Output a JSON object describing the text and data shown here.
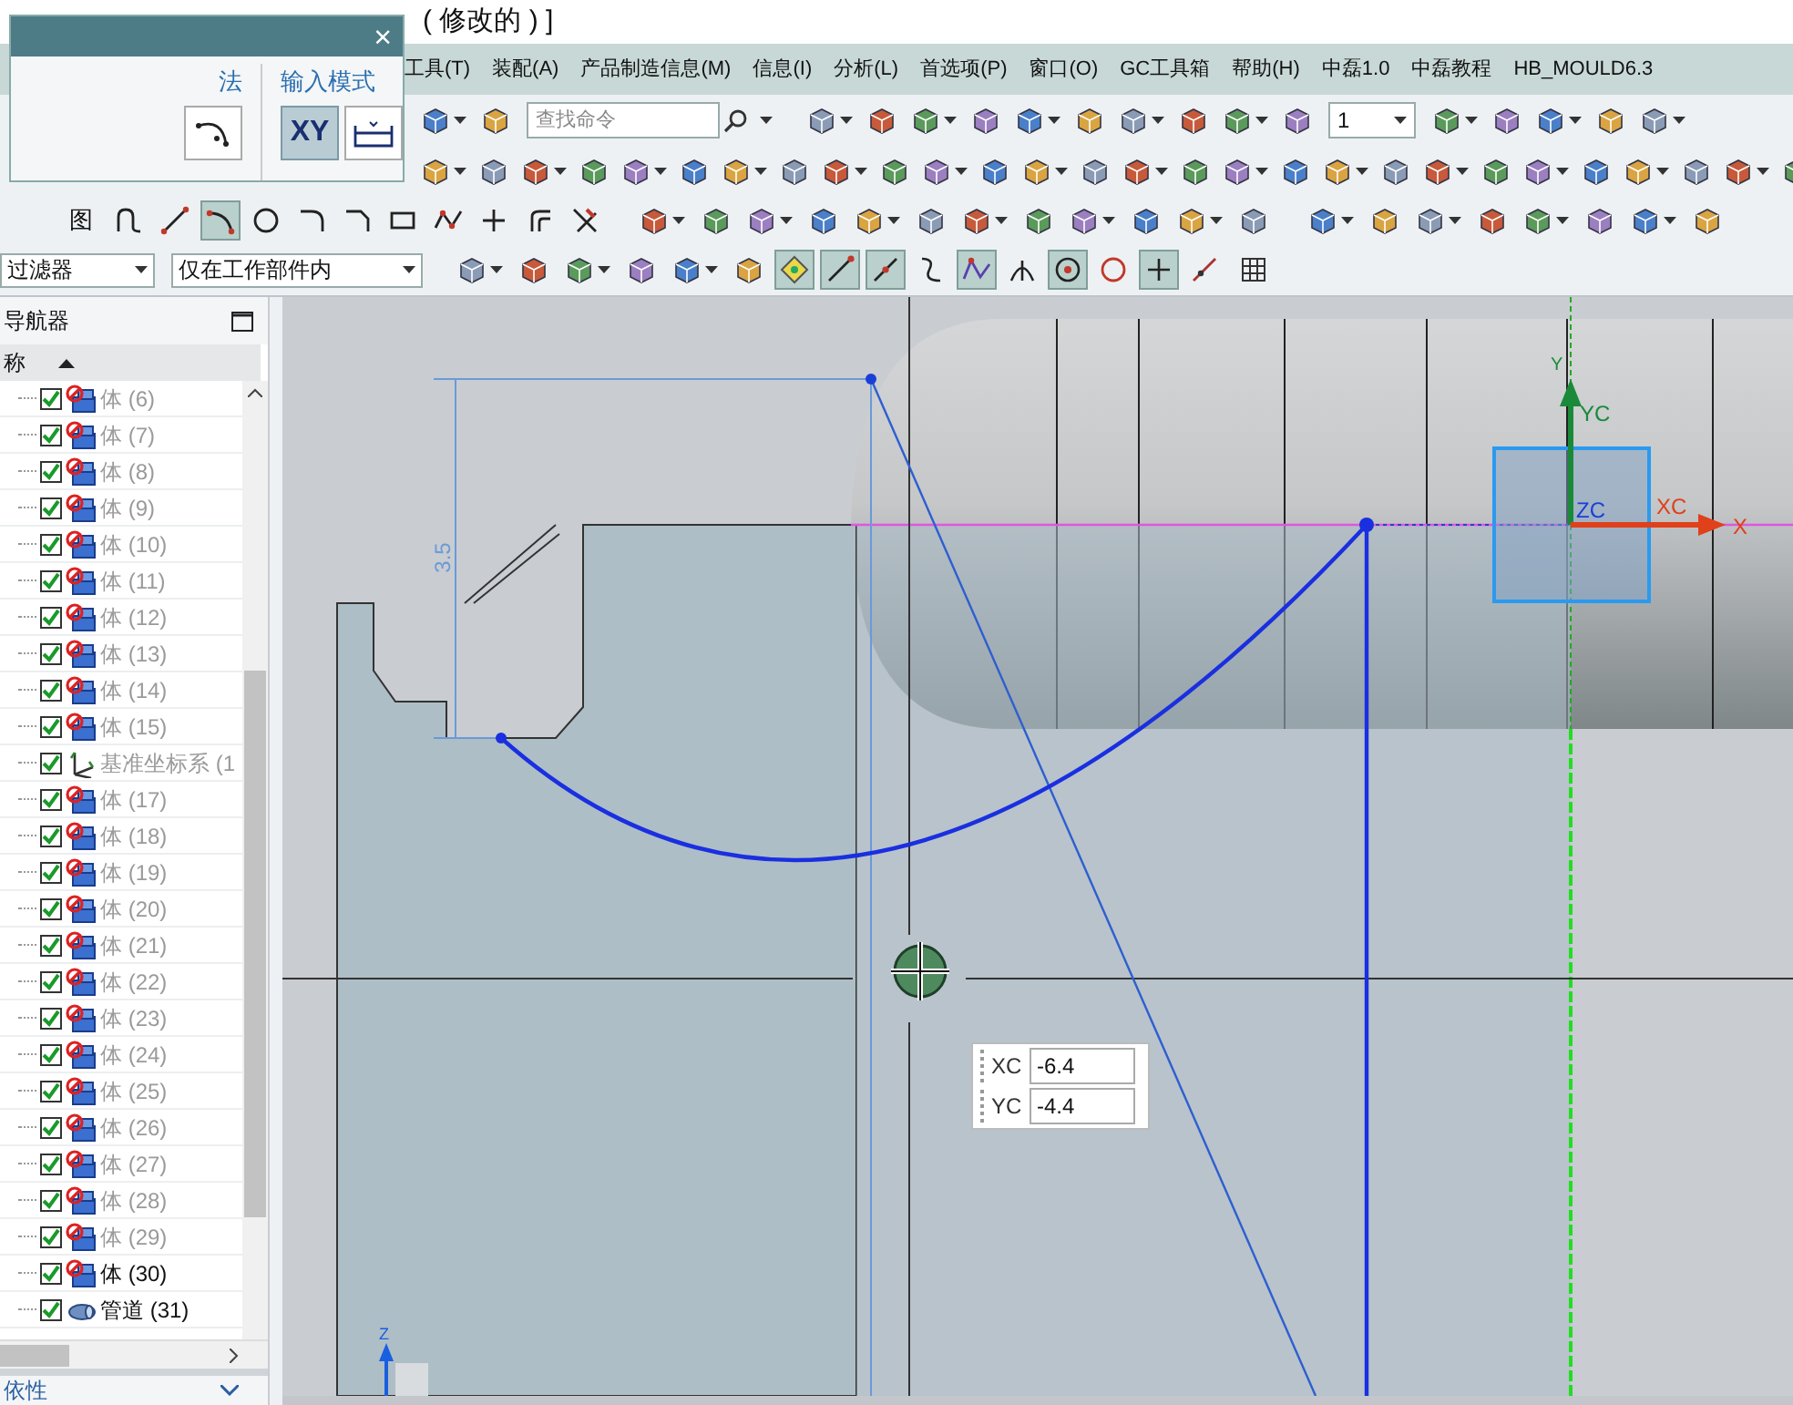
{
  "window": {
    "title": "( 修改的 ) ]"
  },
  "menu": [
    "工具(T)",
    "装配(A)",
    "产品制造信息(M)",
    "信息(I)",
    "分析(L)",
    "首选项(P)",
    "窗口(O)",
    "GC工具箱",
    "帮助(H)",
    "中磊1.0",
    "中磊教程",
    "HB_MOULD6.3"
  ],
  "input_dialog": {
    "close": "×",
    "sections": [
      "法",
      "输入模式"
    ],
    "mode_button": {
      "label": "XY",
      "selected": true
    }
  },
  "toolbar": {
    "search": {
      "placeholder": "查找命令"
    },
    "layer_combo": {
      "value": "1"
    },
    "sketch_label": "图",
    "sketch_tools": [
      {
        "kind": "profile",
        "selected": false
      },
      {
        "kind": "line",
        "selected": false
      },
      {
        "kind": "arc",
        "selected": true
      },
      {
        "kind": "circle",
        "selected": false
      },
      {
        "kind": "fillet",
        "selected": false
      },
      {
        "kind": "chamfer",
        "selected": false
      },
      {
        "kind": "rectangle",
        "selected": false
      },
      {
        "kind": "spline",
        "selected": false
      },
      {
        "kind": "point",
        "selected": false
      },
      {
        "kind": "offset",
        "selected": false
      },
      {
        "kind": "trim",
        "selected": false
      }
    ],
    "filter": {
      "value": "过滤器"
    },
    "scope": {
      "value": "仅在工作部件内"
    },
    "snap_tools": [
      {
        "kind": "auto",
        "selected": true
      },
      {
        "kind": "end",
        "selected": true
      },
      {
        "kind": "mid",
        "selected": true
      },
      {
        "kind": "curve",
        "selected": false
      },
      {
        "kind": "control",
        "selected": true
      },
      {
        "kind": "intersect",
        "selected": false
      },
      {
        "kind": "center",
        "selected": true
      },
      {
        "kind": "quadrant",
        "selected": false
      },
      {
        "kind": "existing",
        "selected": true
      },
      {
        "kind": "oncurve",
        "selected": false
      }
    ]
  },
  "navigator": {
    "title": "导航器",
    "column": "称",
    "footer": "依性",
    "rows": [
      {
        "kind": "body",
        "label": "体 (6)",
        "checked": true,
        "dimmed": true
      },
      {
        "kind": "body",
        "label": "体 (7)",
        "checked": true,
        "dimmed": true
      },
      {
        "kind": "body",
        "label": "体 (8)",
        "checked": true,
        "dimmed": true
      },
      {
        "kind": "body",
        "label": "体 (9)",
        "checked": true,
        "dimmed": true
      },
      {
        "kind": "body",
        "label": "体 (10)",
        "checked": true,
        "dimmed": true
      },
      {
        "kind": "body",
        "label": "体 (11)",
        "checked": true,
        "dimmed": true
      },
      {
        "kind": "body",
        "label": "体 (12)",
        "checked": true,
        "dimmed": true
      },
      {
        "kind": "body",
        "label": "体 (13)",
        "checked": true,
        "dimmed": true
      },
      {
        "kind": "body",
        "label": "体 (14)",
        "checked": true,
        "dimmed": true
      },
      {
        "kind": "body",
        "label": "体 (15)",
        "checked": true,
        "dimmed": true
      },
      {
        "kind": "datum",
        "label": "基准坐标系 (1",
        "checked": true,
        "dimmed": true
      },
      {
        "kind": "body",
        "label": "体 (17)",
        "checked": true,
        "dimmed": true
      },
      {
        "kind": "body",
        "label": "体 (18)",
        "checked": true,
        "dimmed": true
      },
      {
        "kind": "body",
        "label": "体 (19)",
        "checked": true,
        "dimmed": true
      },
      {
        "kind": "body",
        "label": "体 (20)",
        "checked": true,
        "dimmed": true
      },
      {
        "kind": "body",
        "label": "体 (21)",
        "checked": true,
        "dimmed": true
      },
      {
        "kind": "body",
        "label": "体 (22)",
        "checked": true,
        "dimmed": true
      },
      {
        "kind": "body",
        "label": "体 (23)",
        "checked": true,
        "dimmed": true
      },
      {
        "kind": "body",
        "label": "体 (24)",
        "checked": true,
        "dimmed": true
      },
      {
        "kind": "body",
        "label": "体 (25)",
        "checked": true,
        "dimmed": true
      },
      {
        "kind": "body",
        "label": "体 (26)",
        "checked": true,
        "dimmed": true
      },
      {
        "kind": "body",
        "label": "体 (27)",
        "checked": true,
        "dimmed": true
      },
      {
        "kind": "body",
        "label": "体 (28)",
        "checked": true,
        "dimmed": true
      },
      {
        "kind": "body",
        "label": "体 (29)",
        "checked": true,
        "dimmed": true
      },
      {
        "kind": "body",
        "label": "体 (30)",
        "checked": true,
        "dimmed": false
      },
      {
        "kind": "pipe",
        "label": "管道 (31)",
        "checked": true,
        "dimmed": false
      }
    ]
  },
  "canvas": {
    "dimension": "3.5",
    "axes": {
      "y": "Y",
      "yc": "YC",
      "xc": "XC",
      "x": "X",
      "zc": "ZC",
      "z": "Z"
    },
    "coordinate_input": [
      {
        "label": "XC",
        "value": "-6.4"
      },
      {
        "label": "YC",
        "value": "-4.4"
      }
    ]
  }
}
